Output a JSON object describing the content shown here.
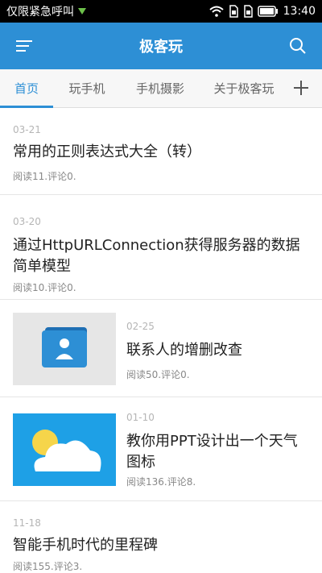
{
  "status_bar": {
    "carrier": "仅限紧急呼叫",
    "time": "13:40",
    "icons": [
      "download-icon",
      "wifi-icon",
      "sim1-icon",
      "sim2-icon",
      "battery-icon"
    ]
  },
  "app_bar": {
    "title": "极客玩",
    "icons": [
      "menu-icon",
      "search-icon"
    ],
    "color": "#2d8fd5"
  },
  "tabs": {
    "items": [
      {
        "label": "首页",
        "active": true
      },
      {
        "label": "玩手机",
        "active": false
      },
      {
        "label": "手机摄影",
        "active": false
      },
      {
        "label": "关于极客玩",
        "active": false
      }
    ],
    "add_icon": "plus-icon"
  },
  "articles": [
    {
      "date": "03-21",
      "title": "常用的正则表达式大全（转）",
      "meta": "阅读11.评论0."
    },
    {
      "date": "03-20",
      "title": "通过HttpURLConnection获得服务器的数据简单模型",
      "meta": "阅读10.评论0."
    },
    {
      "date": "02-25",
      "title": "联系人的增删改查",
      "meta": "阅读50.评论0.",
      "thumbnail": "contacts-icon"
    },
    {
      "date": "01-10",
      "title": "教你用PPT设计出一个天气图标",
      "meta": "阅读136.评论8.",
      "thumbnail": "weather-icon"
    },
    {
      "date": "11-18",
      "title": "智能手机时代的里程碑",
      "meta": "阅读155.评论3."
    }
  ]
}
